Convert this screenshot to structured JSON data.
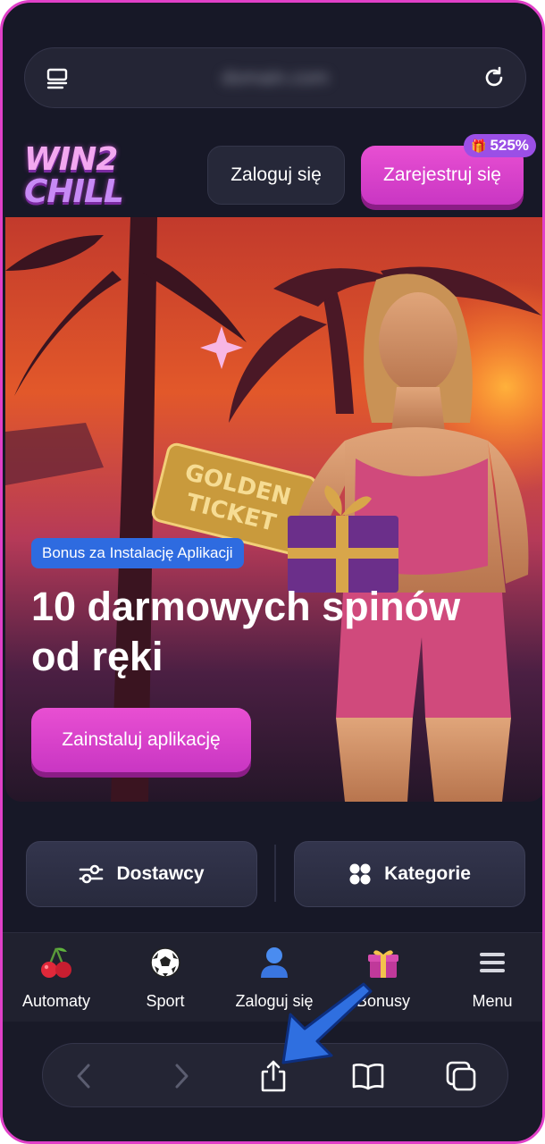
{
  "browser": {
    "url": "domain.com"
  },
  "header": {
    "logo_line1": "WIN2",
    "logo_line2": "CHILL",
    "login_label": "Zaloguj się",
    "register_label": "Zarejestruj się",
    "bonus_badge": "525%"
  },
  "hero": {
    "ticket_text_1": "GOLDEN",
    "ticket_text_2": "TICKET",
    "promo_badge": "Bonus za Instalację Aplikacji",
    "headline_line1": "10 darmowych spinów",
    "headline_line2": "od ręki",
    "install_label": "Zainstaluj aplikację"
  },
  "filters": {
    "providers_label": "Dostawcy",
    "categories_label": "Kategorie"
  },
  "bottom_nav": {
    "items": [
      {
        "label": "Automaty",
        "icon": "cherries-icon"
      },
      {
        "label": "Sport",
        "icon": "soccer-ball-icon"
      },
      {
        "label": "Zaloguj się",
        "icon": "user-icon"
      },
      {
        "label": "Bonusy",
        "icon": "gift-icon"
      },
      {
        "label": "Menu",
        "icon": "menu-icon"
      }
    ]
  },
  "colors": {
    "accent_pink": "#e84fd2",
    "promo_blue": "#2e6be0",
    "background": "#171827",
    "pointer_arrow": "#2f6fe0"
  }
}
